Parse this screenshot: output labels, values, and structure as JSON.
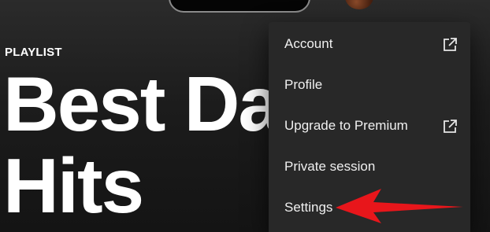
{
  "header": {
    "playlist_label": "PLAYLIST",
    "title": "Best Dance\nHits"
  },
  "menu": {
    "items": [
      {
        "label": "Account",
        "external": true,
        "icon": "external-link-icon"
      },
      {
        "label": "Profile",
        "external": false
      },
      {
        "label": "Upgrade to Premium",
        "external": true,
        "icon": "external-link-icon"
      },
      {
        "label": "Private session",
        "external": false
      },
      {
        "label": "Settings",
        "external": false
      }
    ]
  },
  "annotation": {
    "arrow_color": "#e8161b",
    "arrow_target": "Settings"
  },
  "colors": {
    "menu_bg": "#282828",
    "page_bg": "#121212",
    "text": "#ffffff"
  }
}
